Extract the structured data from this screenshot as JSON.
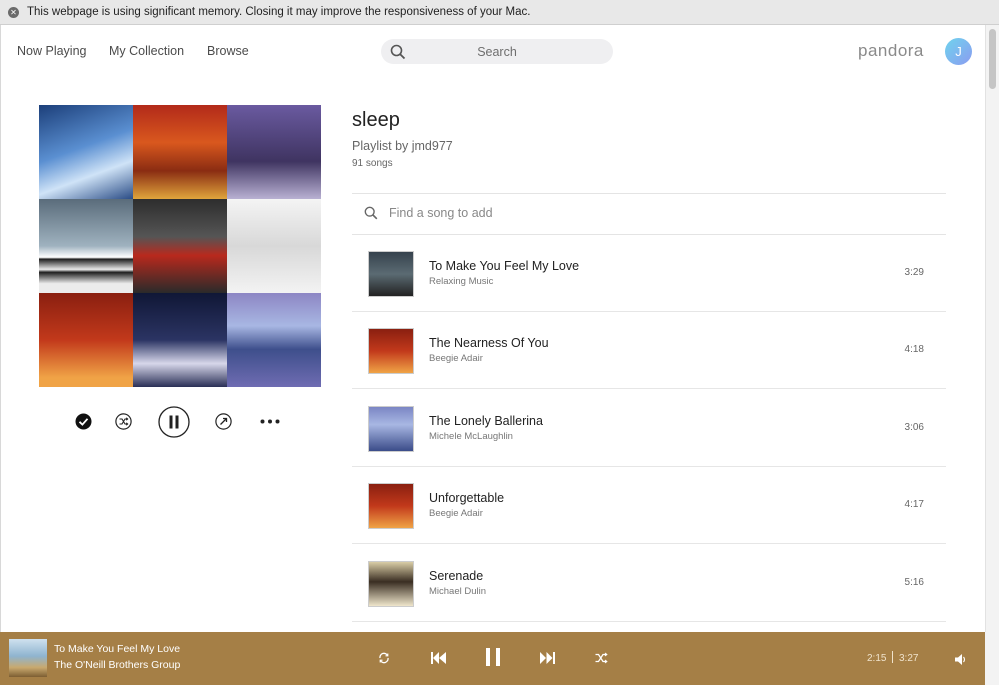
{
  "banner": {
    "text": "This webpage is using significant memory. Closing it may improve the responsiveness of your Mac."
  },
  "nav": {
    "links": [
      "Now Playing",
      "My Collection",
      "Browse"
    ],
    "search_placeholder": "Search",
    "logo": "pandora",
    "avatar_initial": "J"
  },
  "album_grid": {
    "tiles": [
      {
        "icon": "album-art-kevin-kern"
      },
      {
        "icon": "album-art-beegie-adair"
      },
      {
        "icon": "album-art-smokey-robinson"
      },
      {
        "icon": "album-art-solo-piano"
      },
      {
        "icon": "album-art-red-sweater"
      },
      {
        "icon": "album-art-sketch"
      },
      {
        "icon": "album-art-love-letters"
      },
      {
        "icon": "album-art-the-way-you-look-tonight"
      },
      {
        "icon": "album-art-reflections"
      }
    ]
  },
  "controls": [
    "check-icon",
    "shuffle-icon",
    "pause-icon",
    "share-icon",
    "more-icon"
  ],
  "playlist": {
    "title": "sleep",
    "by": "Playlist by jmd977",
    "count": "91 songs",
    "add_placeholder": "Find a song to add",
    "tracks": [
      {
        "title": "To Make You Feel My Love",
        "artist": "Relaxing Music",
        "duration": "3:29"
      },
      {
        "title": "The Nearness Of You",
        "artist": "Beegie Adair",
        "duration": "4:18"
      },
      {
        "title": "The Lonely Ballerina",
        "artist": "Michele McLaughlin",
        "duration": "3:06"
      },
      {
        "title": "Unforgettable",
        "artist": "Beegie Adair",
        "duration": "4:17"
      },
      {
        "title": "Serenade",
        "artist": "Michael Dulin",
        "duration": "5:16"
      }
    ]
  },
  "now_playing": {
    "title": "To Make You Feel My Love",
    "artist": "The O'Neill Brothers Group",
    "elapsed": "2:15",
    "total": "3:27",
    "bar_color": "#a57f46"
  }
}
